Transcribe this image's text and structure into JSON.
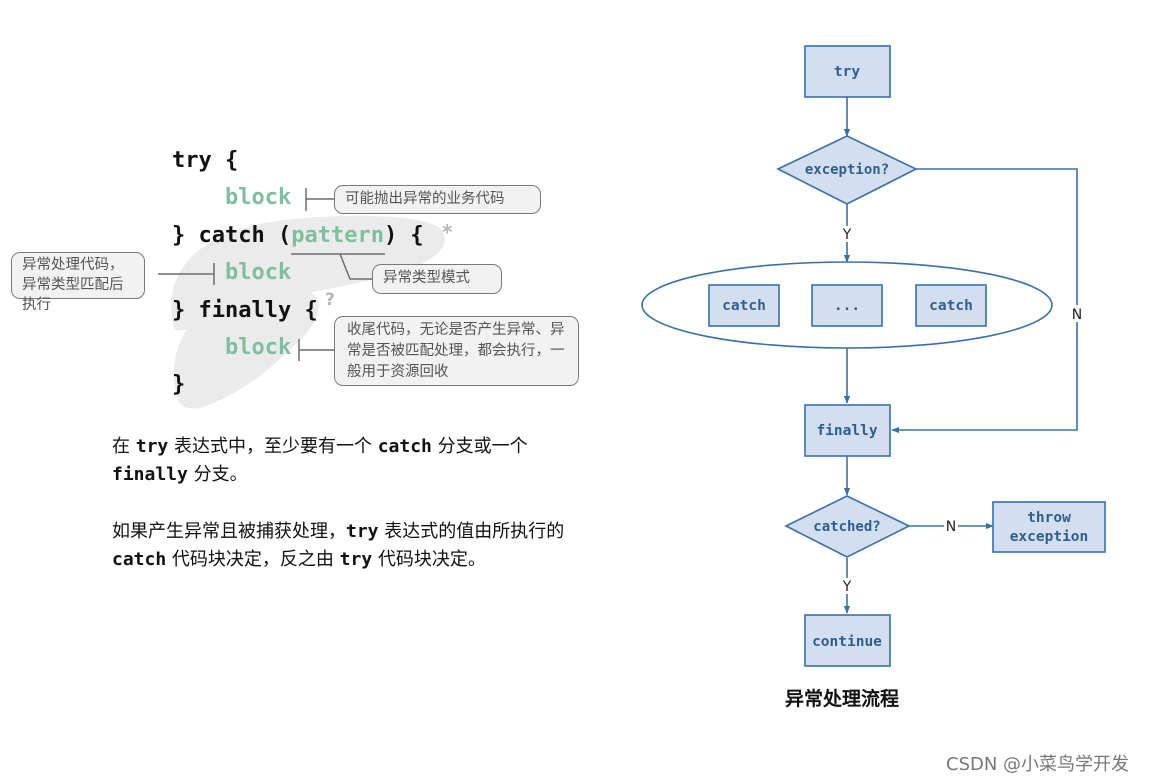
{
  "code_syntax": {
    "lines": {
      "try_open": "try {",
      "try_block": "block",
      "catch_prefix": "} catch (",
      "catch_pattern": "pattern",
      "catch_suffix": ") {",
      "catch_block": "block",
      "finally_open": "} finally {",
      "finally_block": "block",
      "close": "}"
    },
    "marks": {
      "catch_repeat": "*",
      "finally_optional": "?"
    },
    "callouts": {
      "try_block": "可能抛出异常的业务代码",
      "catch_pattern": "异常类型模式",
      "catch_block": "异常处理代码，异常类型匹配后执行",
      "finally_block": "收尾代码，无论是否产生异常、异常是否被匹配处理，都会执行，一般用于资源回收"
    }
  },
  "description": {
    "p1": {
      "t1": "在 ",
      "c1": "try",
      "t2": " 表达式中，至少要有一个 ",
      "c2": "catch",
      "t3": " 分支或一个 ",
      "c3": "finally",
      "t4": " 分支。"
    },
    "p2": {
      "t1": "如果产生异常且被捕获处理，",
      "c1": "try",
      "t2": " 表达式的值由所执行的 ",
      "c2": "catch",
      "t3": " 代码块决定，反之由 ",
      "c3": "try",
      "t4": " 代码块决定。"
    }
  },
  "flowchart": {
    "caption": "异常处理流程",
    "nodes": {
      "try": "try",
      "exception_decision": "exception?",
      "catch1": "catch",
      "catch_more": "...",
      "catch2": "catch",
      "finally": "finally",
      "catched_decision": "catched?",
      "throw_line1": "throw",
      "throw_line2": "exception",
      "continue": "continue"
    },
    "edge_labels": {
      "exception_yes": "Y",
      "exception_no": "N",
      "catched_no": "N",
      "catched_yes": "Y"
    },
    "colors": {
      "node_fill": "#d3dff0",
      "node_stroke": "#3a70a8",
      "node_text": "#2f5f8f"
    }
  },
  "watermark": "CSDN @小菜鸟学开发"
}
